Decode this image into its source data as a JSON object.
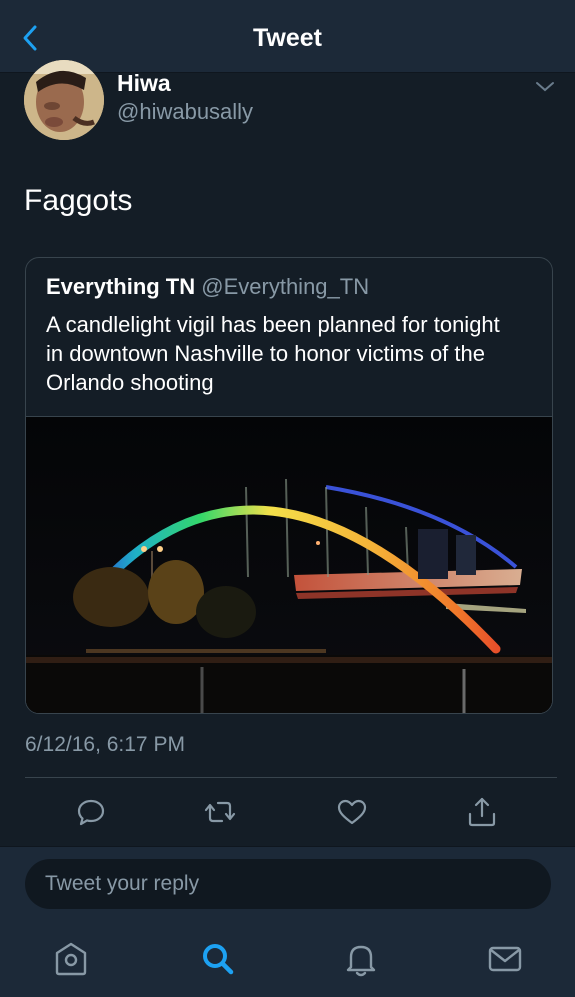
{
  "header": {
    "title": "Tweet"
  },
  "tweet": {
    "author": {
      "name": "Hiwa",
      "handle": "@hiwabusally"
    },
    "text": "Faggots",
    "timestamp": "6/12/16, 6:17 PM",
    "quoted": {
      "name": "Everything TN",
      "handle": "@Everything_TN",
      "text": "A candlelight vigil has been planned for tonight in downtown Nashville to honor victims of the Orlando shooting"
    }
  },
  "actions": [
    "reply-icon",
    "retweet-icon",
    "like-icon",
    "share-icon"
  ],
  "reply": {
    "placeholder": "Tweet your reply"
  },
  "tabbar": {
    "items": [
      "home-icon",
      "search-icon",
      "notifications-icon",
      "messages-icon"
    ],
    "active": "search-icon"
  },
  "colors": {
    "background": "#141d26",
    "bar": "#1c2938",
    "accent": "#1da1f2",
    "muted": "#8899a6"
  }
}
